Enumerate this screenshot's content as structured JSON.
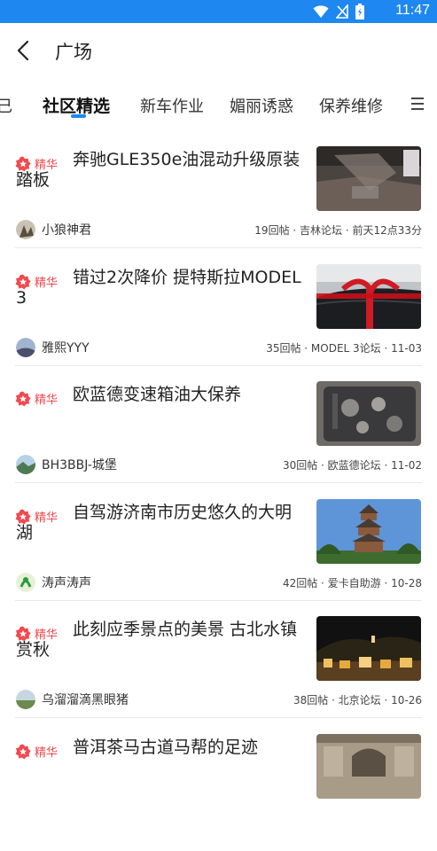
{
  "status": {
    "time": "11:47"
  },
  "header": {
    "title": "广场"
  },
  "tabs": [
    {
      "label": "己"
    },
    {
      "label": "社区精选",
      "active": true
    },
    {
      "label": "新车作业"
    },
    {
      "label": "媚丽诱惑"
    },
    {
      "label": "保养维修"
    }
  ],
  "badge_label": "精华",
  "posts": [
    {
      "title": "奔驰GLE350e油混动升级原装踏板",
      "author": "小狼神君",
      "meta": "19回帖 · 吉林论坛 · 前天12点33分"
    },
    {
      "title": "错过2次降价 提特斯拉MODEL 3",
      "author": "雅熙YYY",
      "meta": "35回帖 · MODEL 3论坛 · 11-03"
    },
    {
      "title": "欧蓝德变速箱油大保养",
      "author": "BH3BBJ-城堡",
      "meta": "30回帖 · 欧蓝德论坛 · 11-02"
    },
    {
      "title": "自驾游济南市历史悠久的大明湖",
      "author": "涛声涛声",
      "meta": "42回帖 · 爱卡自助游 · 10-28"
    },
    {
      "title": "此刻应季景点的美景 古北水镇赏秋",
      "author": "乌溜溜滴黑眼猪",
      "meta": "38回帖 · 北京论坛 · 10-26"
    },
    {
      "title": "普洱茶马古道马帮的足迹",
      "author": "",
      "meta": ""
    }
  ],
  "colors": {
    "statusbar": "#1e88f0",
    "accent": "#1e88f0",
    "badge": "#f2494f"
  }
}
